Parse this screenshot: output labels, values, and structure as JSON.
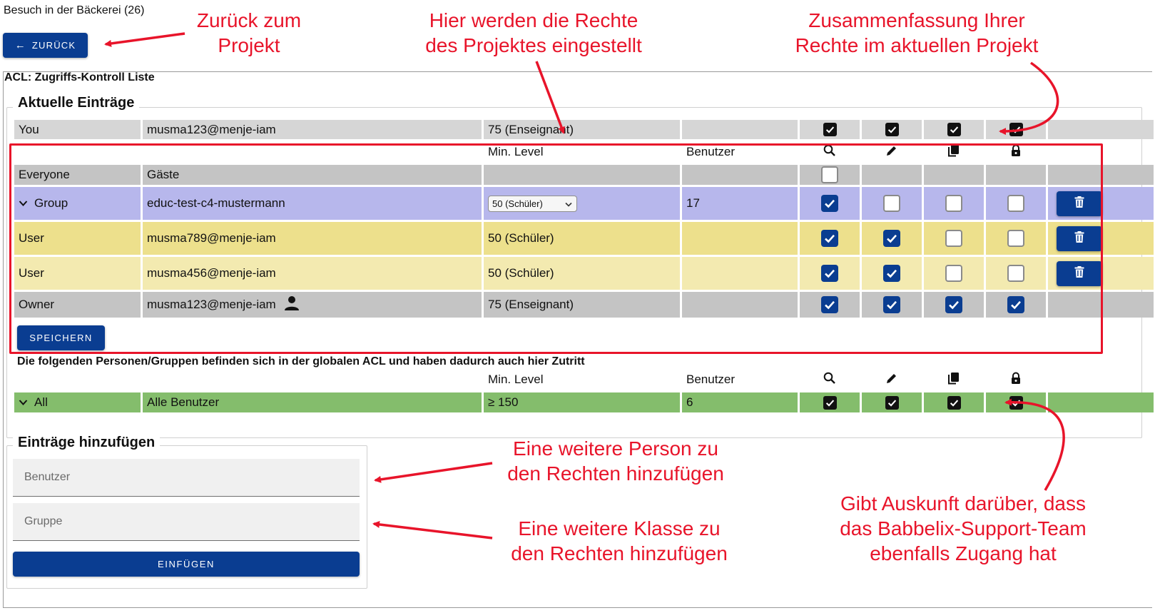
{
  "header": {
    "title": "Besuch in der Bäckerei (26)",
    "back_label": "ZURÜCK"
  },
  "acl": {
    "title": "ACL: Zugriffs-Kontroll Liste",
    "current": {
      "legend": "Aktuelle Einträge",
      "you_row": {
        "type": "You",
        "name": "musma123@menje-iam",
        "level": "75 (Enseignant)",
        "perms": [
          true,
          true,
          true,
          true
        ]
      },
      "headers": {
        "min_level": "Min. Level",
        "users": "Benutzer"
      },
      "permission_icons": [
        "search-icon",
        "pencil-icon",
        "copy-icon",
        "lock-icon"
      ],
      "rows": [
        {
          "type": "Everyone",
          "name": "Gäste",
          "level": "",
          "users": "",
          "perms": [
            false
          ]
        },
        {
          "type": "Group",
          "name": "educ-test-c4-mustermann",
          "level": "50 (Schüler)",
          "users": "17",
          "perms": [
            true,
            false,
            false,
            false
          ]
        },
        {
          "type": "User",
          "name": "musma789@menje-iam",
          "level": "50 (Schüler)",
          "users": "",
          "perms": [
            true,
            true,
            false,
            false
          ]
        },
        {
          "type": "User",
          "name": "musma456@menje-iam",
          "level": "50 (Schüler)",
          "users": "",
          "perms": [
            true,
            true,
            false,
            false
          ]
        },
        {
          "type": "Owner",
          "name": "musma123@menje-iam",
          "level": "75 (Enseignant)",
          "users": "",
          "perms": [
            true,
            true,
            true,
            true
          ]
        }
      ],
      "save_label": "SPEICHERN"
    },
    "global": {
      "note": "Die folgenden Personen/Gruppen befinden sich in der globalen ACL und haben dadurch auch hier Zutritt",
      "headers": {
        "min_level": "Min. Level",
        "users": "Benutzer"
      },
      "row": {
        "type": "All",
        "name": "Alle Benutzer",
        "level": "≥ 150",
        "users": "6",
        "perms": [
          true,
          true,
          true,
          true
        ]
      }
    },
    "add": {
      "legend": "Einträge hinzufügen",
      "user_placeholder": "Benutzer",
      "group_placeholder": "Gruppe",
      "insert_label": "EINFÜGEN"
    }
  },
  "annotations": {
    "back_line1": "Zurück zum",
    "back_line2": "Projekt",
    "rights_line1": "Hier werden die Rechte",
    "rights_line2": "des Projektes eingestellt",
    "summary_line1": "Zusammenfassung Ihrer",
    "summary_line2": "Rechte im aktuellen Projekt",
    "person_line1": "Eine weitere Person zu",
    "person_line2": "den Rechten hinzufügen",
    "class_line1": "Eine weitere Klasse zu",
    "class_line2": "den Rechten hinzufügen",
    "support_line1": "Gibt Auskunft darüber, dass",
    "support_line2": "das Babbelix-Support-Team",
    "support_line3": "ebenfalls Zugang hat"
  },
  "colors": {
    "primary": "#0a3d91",
    "annotation_red": "#e8142a",
    "row_grey": "#d6d6d6",
    "group_purple": "#b7b7ec",
    "user_yellow": "#ede08c",
    "user_yellow_light": "#f3eab0",
    "global_green": "#84bd6c"
  }
}
